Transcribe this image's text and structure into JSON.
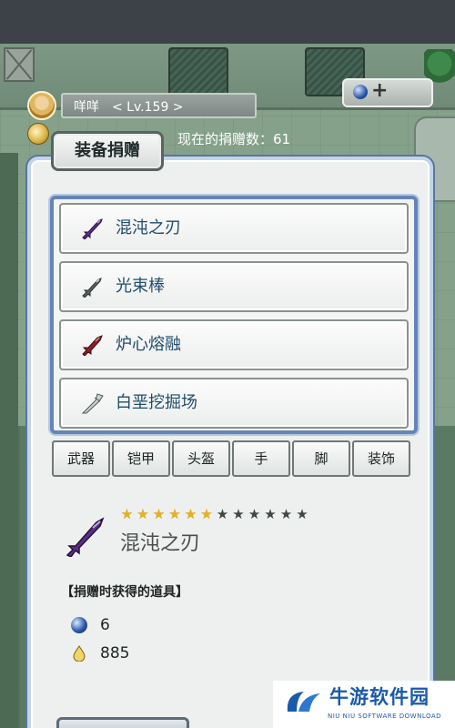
{
  "player": {
    "name": "咩咩",
    "level": "< Lv.159 >"
  },
  "donation": {
    "count_text": "现在的捐赠数：61"
  },
  "panel": {
    "title": "装备捐赠"
  },
  "items": [
    {
      "name": "混沌之刃",
      "icon": "chaos-blade-icon",
      "color": "#5a2f86"
    },
    {
      "name": "光束棒",
      "icon": "beam-rod-icon",
      "color": "#4a5252"
    },
    {
      "name": "炉心熔融",
      "icon": "meltdown-sword-icon",
      "color": "#8e1e24"
    },
    {
      "name": "白垩挖掘场",
      "icon": "chalk-dig-icon",
      "color": "#6f7d7a"
    }
  ],
  "tabs": [
    "武器",
    "铠甲",
    "头盔",
    "手",
    "脚",
    "装饰"
  ],
  "detail": {
    "name": "混沌之刃",
    "stars_filled": 6,
    "stars_total": 12,
    "icon": "chaos-blade-icon"
  },
  "rewards": {
    "title": "【捐赠时获得的道具】",
    "list": [
      {
        "icon": "orb-icon",
        "value": "6"
      },
      {
        "icon": "drop-icon",
        "value": "885"
      }
    ]
  },
  "watermark": {
    "name": "牛游软件园",
    "sub": "NIU NIU SOFTWARE DOWNLOAD"
  }
}
